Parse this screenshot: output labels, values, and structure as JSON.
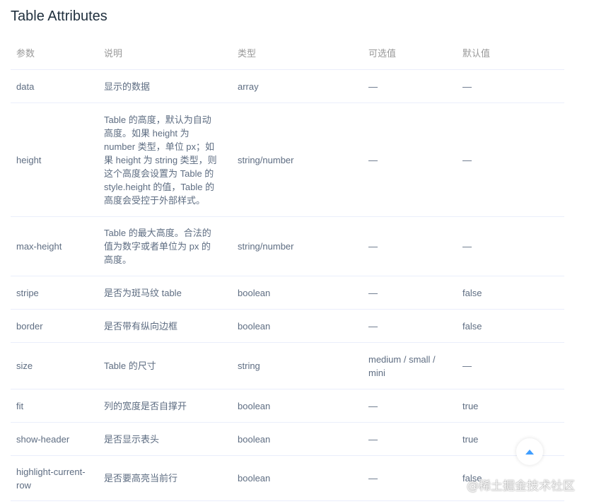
{
  "title": "Table Attributes",
  "headers": {
    "param": "参数",
    "desc": "说明",
    "type": "类型",
    "options": "可选值",
    "default": "默认值"
  },
  "rows": [
    {
      "param": "data",
      "desc": "显示的数据",
      "type": "array",
      "options": "—",
      "default": "—"
    },
    {
      "param": "height",
      "desc": "Table 的高度，默认为自动高度。如果 height 为 number 类型，单位 px；如果 height 为 string 类型，则这个高度会设置为 Table 的 style.height 的值，Table 的高度会受控于外部样式。",
      "type": "string/number",
      "options": "—",
      "default": "—"
    },
    {
      "param": "max-height",
      "desc": "Table 的最大高度。合法的值为数字或者单位为 px 的高度。",
      "type": "string/number",
      "options": "—",
      "default": "—"
    },
    {
      "param": "stripe",
      "desc": "是否为斑马纹 table",
      "type": "boolean",
      "options": "—",
      "default": "false"
    },
    {
      "param": "border",
      "desc": "是否带有纵向边框",
      "type": "boolean",
      "options": "—",
      "default": "false"
    },
    {
      "param": "size",
      "desc": "Table 的尺寸",
      "type": "string",
      "options": "medium / small / mini",
      "default": "—"
    },
    {
      "param": "fit",
      "desc": "列的宽度是否自撑开",
      "type": "boolean",
      "options": "—",
      "default": "true"
    },
    {
      "param": "show-header",
      "desc": "是否显示表头",
      "type": "boolean",
      "options": "—",
      "default": "true"
    },
    {
      "param": "highlight-current-row",
      "desc": "是否要高亮当前行",
      "type": "boolean",
      "options": "—",
      "default": "false"
    }
  ],
  "scroll_top": {
    "icon": "caret-up-icon",
    "color": "#409eff"
  },
  "watermark": "@稀土掘金技术社区"
}
